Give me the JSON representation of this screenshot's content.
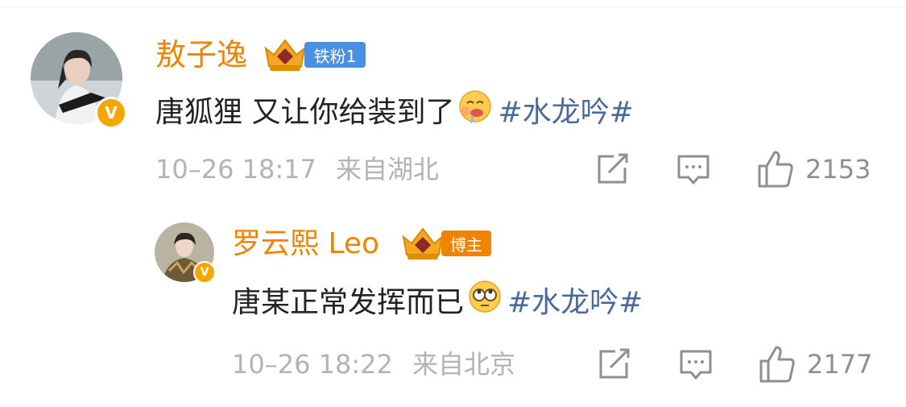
{
  "comments": [
    {
      "username": "敖子逸",
      "level_icon": "crown-level-icon",
      "fan_badge": "铁粉1",
      "text": "唐狐狸 又让你给装到了",
      "emoji": "drooling-emoji",
      "hashtag": "#水龙吟#",
      "time": "10–26 18:17",
      "location": "来自湖北",
      "likes": "2153",
      "verified": "V",
      "colors": {
        "name": "#f08300",
        "badge": "#4a90e2",
        "hashtag": "#4b6a9c"
      }
    },
    {
      "username": "罗云熙 Leo",
      "level_icon": "crown-level-icon",
      "fan_badge": "博主",
      "text": "唐某正常发挥而已",
      "emoji": "eye-roll-emoji",
      "hashtag": "#水龙吟#",
      "time": "10–26 18:22",
      "location": "来自北京",
      "likes": "2177",
      "verified": "V",
      "colors": {
        "name": "#f08300",
        "badge": "#f08300",
        "hashtag": "#4b6a9c"
      }
    }
  ]
}
